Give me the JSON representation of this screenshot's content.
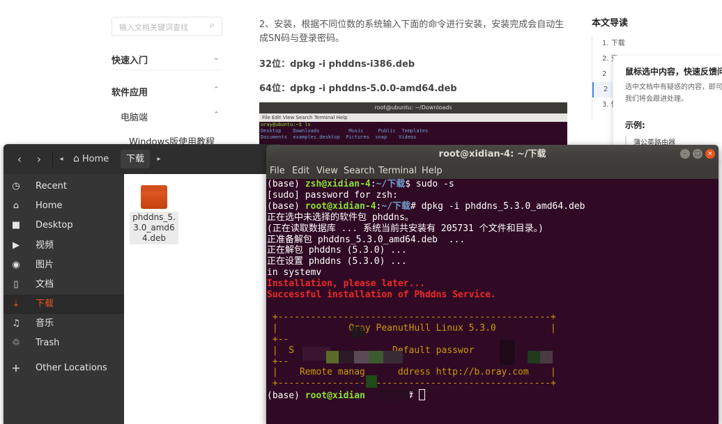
{
  "webpage": {
    "search_placeholder": "输入文档关键词查找",
    "nav": [
      {
        "label": "快速入门",
        "chevron": "⌄"
      },
      {
        "label": "软件应用",
        "chevron": "⌃"
      }
    ],
    "sub_nav": {
      "label": "电脑端",
      "chevron": "⌃"
    },
    "sub_sub_nav": {
      "label": "Windows版使用教程"
    },
    "article": {
      "paragraph": "2、安装，根据不同位数的系统输入下面的命令进行安装，安装完成会自动生成SN码与登录密码。",
      "line32": "32位：dpkg -i phddns-i386.deb",
      "line64": "64位：dpkg -i phddns-5.0.0-amd64.deb",
      "screenshot": {
        "title": "root@ubuntu: ~/Downloads",
        "menu": "File  Edit  View  Search  Terminal  Help",
        "line1": "oray@ubuntu:~$ ls",
        "line2": "Desktop    Downloads          Music     Public  Templates",
        "line3": "Documents  examples.desktop  Pictures  snap    Videos"
      }
    },
    "toc": {
      "title": "本文导读",
      "items": [
        "1. 下载",
        "2. 安",
        "2",
        "2",
        "3. 使"
      ]
    },
    "popup": {
      "title": "鼠标选中内容，快速反馈问题",
      "desc_line1": "选中文档中有疑惑的内容，即可快速反馈问题，",
      "desc_line2": "我们将会跟进处理。",
      "example_label": "示例:",
      "example": "蒲公英路由器"
    }
  },
  "files": {
    "header": {
      "home_label": "Home",
      "current_folder": "下载"
    },
    "sidebar": [
      {
        "label": "Recent",
        "icon": "clock-icon",
        "glyph": "◷"
      },
      {
        "label": "Home",
        "icon": "home-icon",
        "glyph": "⌂"
      },
      {
        "label": "Desktop",
        "icon": "folder-icon",
        "glyph": "■"
      },
      {
        "label": "视频",
        "icon": "video-icon",
        "glyph": "▶"
      },
      {
        "label": "图片",
        "icon": "camera-icon",
        "glyph": "◉"
      },
      {
        "label": "文档",
        "icon": "document-icon",
        "glyph": "▯"
      },
      {
        "label": "下载",
        "icon": "download-icon",
        "glyph": "⇣"
      },
      {
        "label": "音乐",
        "icon": "music-icon",
        "glyph": "♫"
      },
      {
        "label": "Trash",
        "icon": "trash-icon",
        "glyph": "♲"
      },
      {
        "label": "Other Locations",
        "icon": "plus-icon",
        "glyph": "+"
      }
    ],
    "file_name": "phddns_5.3.0_amd64.deb",
    "file_name_display": "phddns_\n5.3.0_\namd64.deb"
  },
  "terminal": {
    "title": "root@xidian-4: ~/下载",
    "menu": [
      "File",
      "Edit",
      "View",
      "Search",
      "Terminal",
      "Help"
    ],
    "lines": {
      "l1_prefix": "(base) ",
      "l1_user": "zsh@xidian-4",
      "l1_sep": ":",
      "l1_path": "~/下载",
      "l1_cmd": "$ sudo -s",
      "l2": "[sudo] password for zsh:",
      "l3_prefix": "(base) ",
      "l3_user": "root@xidian-4",
      "l3_sep": ":",
      "l3_path": "~/下载",
      "l3_cmd": "# dpkg -i phddns_5.3.0_amd64.deb",
      "l4": "正在选中未选择的软件包 phddns。",
      "l5": "(正在读取数据库 ... 系统当前共安装有 205731 个文件和目录。)",
      "l6": "正准备解包 phddns_5.3.0_amd64.deb  ...",
      "l7": "正在解包 phddns (5.3.0) ...",
      "l8": "正在设置 phddns (5.3.0) ...",
      "l9": "in systemv",
      "l10": "Installation, please later...",
      "l11": "Successful installation of Phddns Service.",
      "box_border": " +--------------------------------------------------+",
      "box_title": " |             Oray PeanutHull Linux 5.3.0          |",
      "box_div": " +--",
      "box_sn": " |  S                  Default passwor",
      "box_div2": " +--",
      "box_remote": " |    Remote manag      ddress http://b.oray.com    |",
      "box_bottom": " +--------------------------------------------------+",
      "last_prefix": "(base) ",
      "last_user": "root@xidian",
      "last_path": "载",
      "last_cmd": "# "
    }
  },
  "colors": {
    "terminal_bg": "#300a24",
    "prompt_green": "#8ae234",
    "path_blue": "#729fcf",
    "error_red": "#ef2929",
    "ubuntu_orange": "#e95420"
  }
}
